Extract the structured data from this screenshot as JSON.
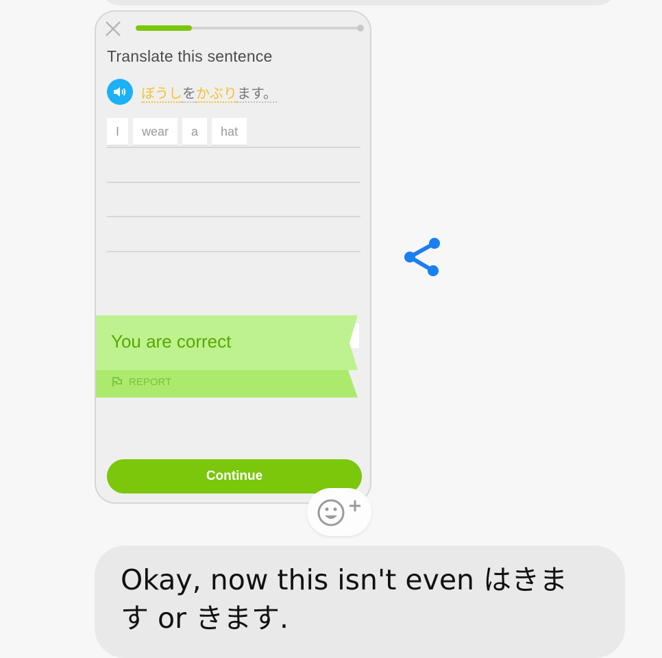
{
  "lesson": {
    "progress_fraction": 0.25,
    "prompt_title": "Translate this sentence",
    "sentence_parts": [
      {
        "text": "ぼうし",
        "style": "highlight"
      },
      {
        "text": "を",
        "style": "plain"
      },
      {
        "text": "かぶり",
        "style": "highlight"
      },
      {
        "text": "ます。",
        "style": "plain"
      }
    ],
    "answer_tiles": [
      "I",
      "wear",
      "a",
      "hat"
    ],
    "feedback": "You are correct",
    "report_label": "REPORT",
    "continue_label": "Continue"
  },
  "message": {
    "text": "Okay, now this isn't even はきます or きます."
  },
  "colors": {
    "accent_green": "#7ac70c",
    "banner_green": "#bef28f",
    "speaker_blue": "#1cb0f6",
    "share_blue": "#1a7ff0",
    "highlight_yellow": "#f5c12e"
  },
  "icons": [
    "close-icon",
    "speaker-icon",
    "report-flag-icon",
    "share-icon",
    "add-reaction-icon"
  ]
}
